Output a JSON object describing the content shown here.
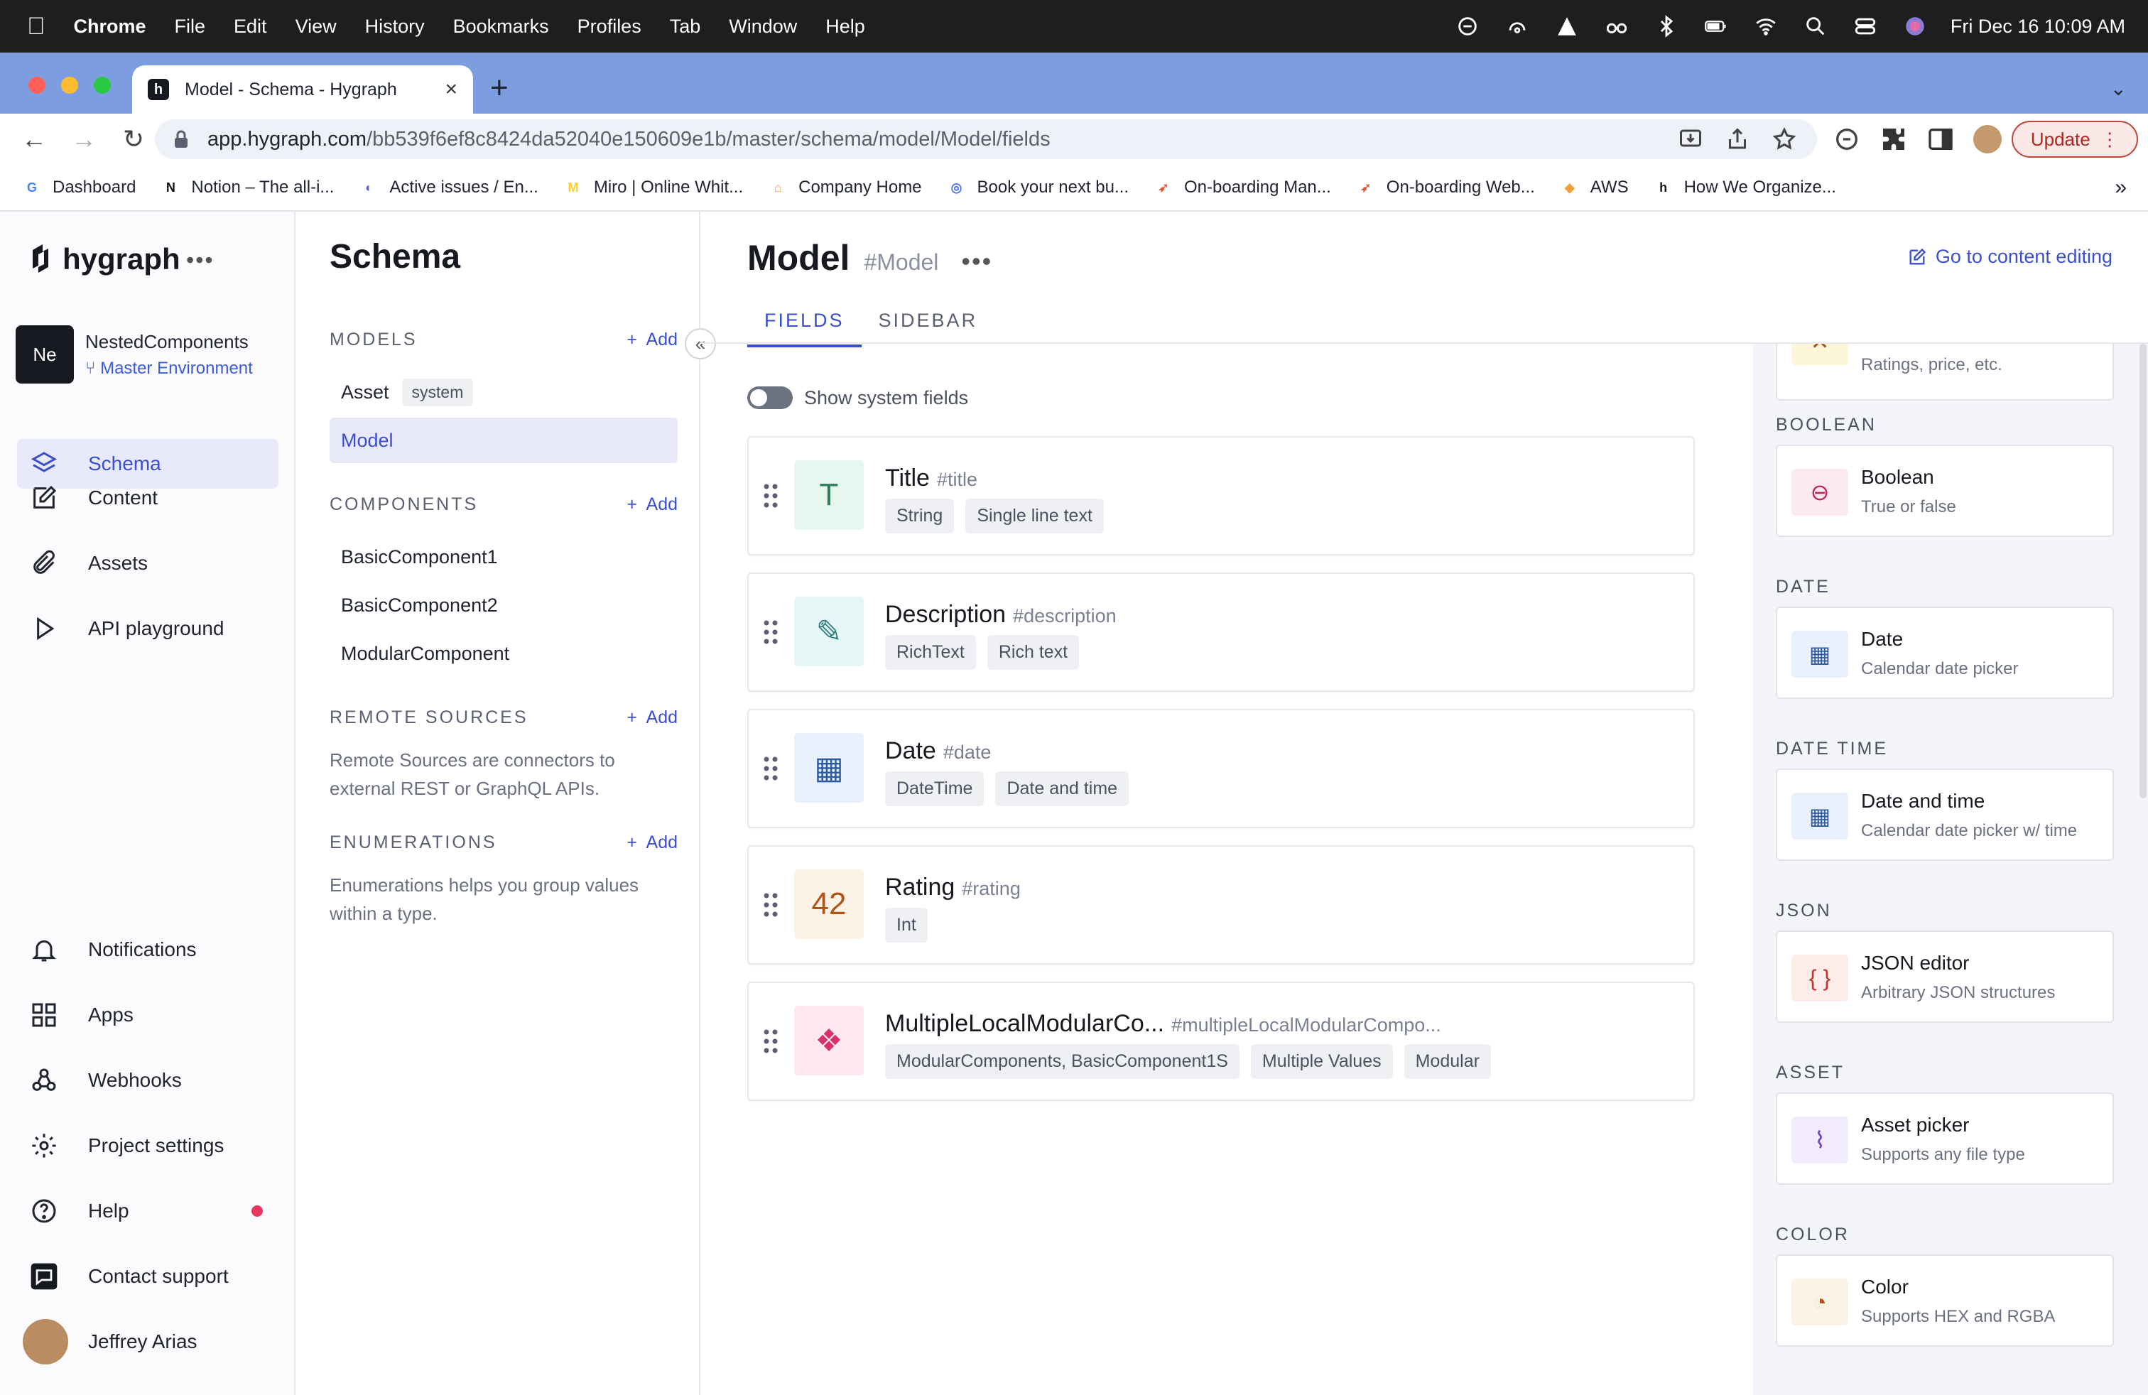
{
  "menubar": {
    "app": "Chrome",
    "items": [
      "File",
      "Edit",
      "View",
      "History",
      "Bookmarks",
      "Profiles",
      "Tab",
      "Window",
      "Help"
    ],
    "datetime": "Fri Dec 16  10:09 AM"
  },
  "browser": {
    "tab_title": "Model - Schema - Hygraph",
    "url_host": "app.hygraph.com",
    "url_path": "/bb539f6ef8c8424da52040e150609e1b/master/schema/model/Model/fields",
    "update_label": "Update",
    "bookmarks": [
      {
        "label": "Dashboard",
        "icon": "google-icon",
        "color": "#4285f4"
      },
      {
        "label": "Notion – The all-i...",
        "icon": "notion-icon",
        "color": "#111111"
      },
      {
        "label": "Active issues / En...",
        "icon": "linear-icon",
        "color": "#5e6ad2"
      },
      {
        "label": "Miro | Online Whit...",
        "icon": "miro-icon",
        "color": "#ffd02f"
      },
      {
        "label": "Company Home",
        "icon": "home-icon",
        "color": "#f29d38"
      },
      {
        "label": "Book your next bu...",
        "icon": "booking-icon",
        "color": "#4a6cf7"
      },
      {
        "label": "On-boarding Man...",
        "icon": "rocket-icon",
        "color": "#e0553b"
      },
      {
        "label": "On-boarding Web...",
        "icon": "rocket-icon",
        "color": "#e0553b"
      },
      {
        "label": "AWS",
        "icon": "aws-icon",
        "color": "#f29d38"
      },
      {
        "label": "How We Organize...",
        "icon": "hygraph-icon",
        "color": "#16191f"
      }
    ]
  },
  "sidebar": {
    "brand": "hygraph",
    "project_badge": "Ne",
    "project_name": "NestedComponents",
    "environment": "Master Environment",
    "nav_top": [
      {
        "label": "Schema",
        "icon": "layers-icon"
      },
      {
        "label": "Content",
        "icon": "edit-icon"
      },
      {
        "label": "Assets",
        "icon": "paperclip-icon"
      },
      {
        "label": "API playground",
        "icon": "play-icon"
      }
    ],
    "nav_bottom": [
      {
        "label": "Notifications",
        "icon": "bell-icon"
      },
      {
        "label": "Apps",
        "icon": "grid-icon"
      },
      {
        "label": "Webhooks",
        "icon": "webhook-icon"
      },
      {
        "label": "Project settings",
        "icon": "gear-icon"
      },
      {
        "label": "Help",
        "icon": "help-icon"
      },
      {
        "label": "Contact support",
        "icon": "chat-icon"
      }
    ],
    "user_name": "Jeffrey Arias"
  },
  "schema": {
    "title": "Schema",
    "models_label": "MODELS",
    "add_label": "Add",
    "models": [
      {
        "name": "Asset",
        "tag": "system"
      },
      {
        "name": "Model",
        "tag": ""
      }
    ],
    "components_label": "COMPONENTS",
    "components": [
      "BasicComponent1",
      "BasicComponent2",
      "ModularComponent"
    ],
    "remote_label": "REMOTE SOURCES",
    "remote_desc": "Remote Sources are connectors to external REST or GraphQL APIs.",
    "enum_label": "ENUMERATIONS",
    "enum_desc": "Enumerations helps you group values within a type."
  },
  "main": {
    "title": "Model",
    "api_id": "#Model",
    "goto_label": "Go to content editing",
    "tabs": [
      "FIELDS",
      "SIDEBAR"
    ],
    "toggle_label": "Show system fields",
    "fields": [
      {
        "name": "Title",
        "api": "#title",
        "tags": [
          "String",
          "Single line text"
        ],
        "icon": "T",
        "icon_color": "#2f7d5b",
        "icon_bg": "#e7f6ee"
      },
      {
        "name": "Description",
        "api": "#description",
        "tags": [
          "RichText",
          "Rich text"
        ],
        "icon": "✎",
        "icon_color": "#2f7d7d",
        "icon_bg": "#e5f6f5"
      },
      {
        "name": "Date",
        "api": "#date",
        "tags": [
          "DateTime",
          "Date and time"
        ],
        "icon": "▦",
        "icon_color": "#2f5b9d",
        "icon_bg": "#e8f0fb"
      },
      {
        "name": "Rating",
        "api": "#rating",
        "tags": [
          "Int"
        ],
        "icon": "42",
        "icon_color": "#b0541a",
        "icon_bg": "#fdf2e6"
      },
      {
        "name": "MultipleLocalModularCo...",
        "api": "#multipleLocalModularCompo...",
        "tags": [
          "ModularComponents, BasicComponent1S",
          "Multiple Values",
          "Modular"
        ],
        "icon": "❖",
        "icon_color": "#d6336c",
        "icon_bg": "#fde8ef"
      }
    ]
  },
  "right_panel": {
    "top_partial_desc": "Ratings, price, etc.",
    "sections": [
      {
        "label": "BOOLEAN",
        "card_title": "Boolean",
        "card_desc": "True or false",
        "icon": "toggle-icon",
        "color": "#c2255c",
        "bg": "#fdeaf1"
      },
      {
        "label": "DATE",
        "card_title": "Date",
        "card_desc": "Calendar date picker",
        "icon": "calendar-icon",
        "color": "#2f5b9d",
        "bg": "#e8f0fb"
      },
      {
        "label": "DATE TIME",
        "card_title": "Date and time",
        "card_desc": "Calendar date picker w/ time",
        "icon": "calendar-icon",
        "color": "#2f5b9d",
        "bg": "#e8f0fb"
      },
      {
        "label": "JSON",
        "card_title": "JSON editor",
        "card_desc": "Arbitrary JSON structures",
        "icon": "braces-icon",
        "color": "#c0392b",
        "bg": "#fdecea"
      },
      {
        "label": "ASSET",
        "card_title": "Asset picker",
        "card_desc": "Supports any file type",
        "icon": "paperclip-icon",
        "color": "#6f42c1",
        "bg": "#f1ebfb"
      },
      {
        "label": "COLOR",
        "card_title": "Color",
        "card_desc": "Supports HEX and RGBA",
        "icon": "palette-icon",
        "color": "#b0541a",
        "bg": "#fdf2e6"
      }
    ]
  }
}
